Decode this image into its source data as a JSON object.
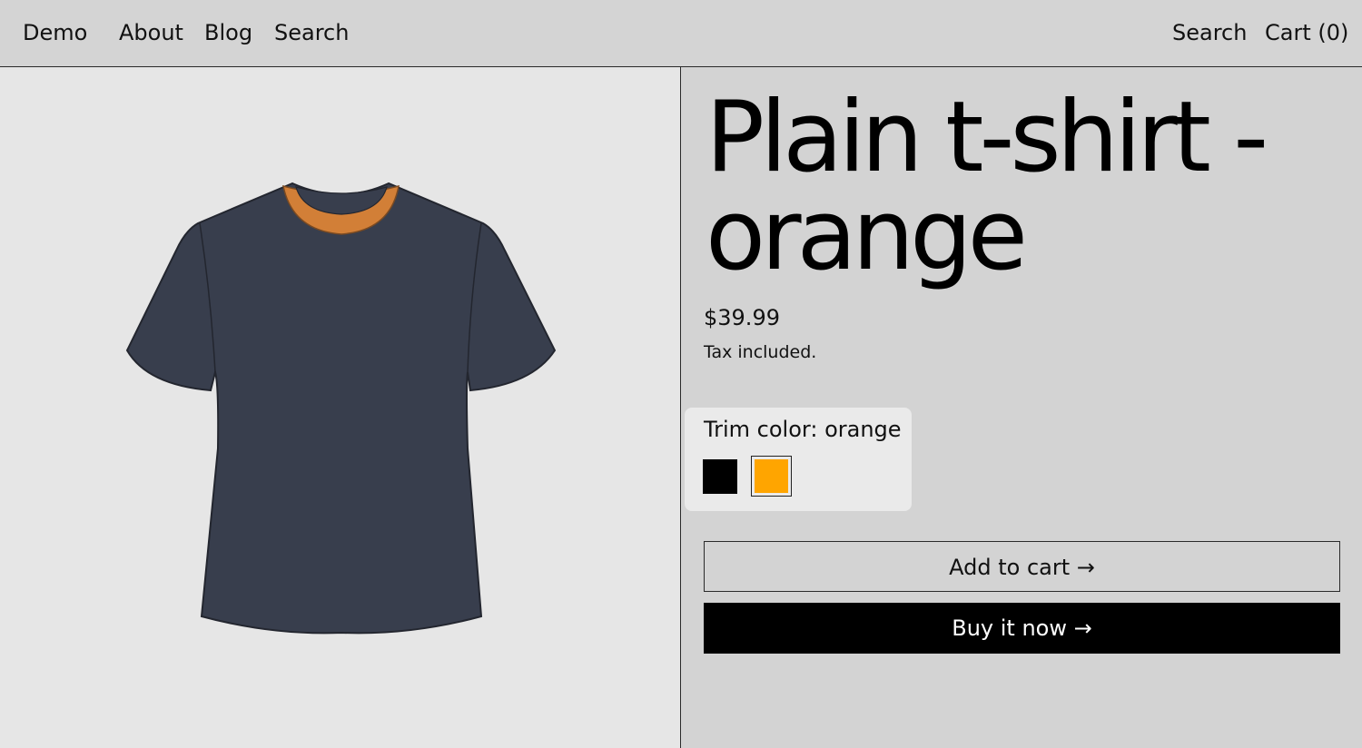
{
  "header": {
    "brand": "Demo",
    "nav": [
      "About",
      "Blog",
      "Search"
    ],
    "right": {
      "search": "Search",
      "cart": "Cart (0)"
    }
  },
  "product": {
    "title": "Plain t-shirt - orange",
    "price": "$39.99",
    "tax_note": "Tax included.",
    "variant": {
      "label": "Trim color: orange",
      "options": [
        {
          "name": "black",
          "color": "#000000",
          "selected": false
        },
        {
          "name": "orange",
          "color": "#ffa500",
          "selected": true
        }
      ]
    },
    "image": {
      "shirt_color": "#383e4d",
      "trim_color": "#d27f37"
    }
  },
  "actions": {
    "add_to_cart": "Add to cart  →",
    "buy_now": "Buy it now →"
  },
  "colors": {
    "background": "#d3d3d3",
    "image_background": "#e6e6e6",
    "button_primary": "#000000"
  }
}
